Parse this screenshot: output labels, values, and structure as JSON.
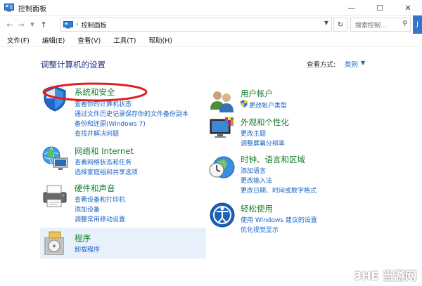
{
  "window": {
    "title": "控制面板"
  },
  "address": {
    "crumb": "控制面板",
    "separator": "›"
  },
  "search": {
    "placeholder": "搜索控制..."
  },
  "side_tab": "J",
  "menubar": {
    "items": [
      "文件(F)",
      "编辑(E)",
      "查看(V)",
      "工具(T)",
      "帮助(H)"
    ]
  },
  "main": {
    "heading": "调整计算机的设置",
    "view_by_label": "查看方式:",
    "view_by_value": "类别"
  },
  "left_categories": [
    {
      "title": "系统和安全",
      "links": [
        "查看你的计算机状态",
        "通过文件历史记录保存你的文件备份副本",
        "备份和还原(Windows 7)",
        "查找并解决问题"
      ]
    },
    {
      "title": "网络和 Internet",
      "links": [
        "查看网络状态和任务",
        "选择家庭组和共享选项"
      ]
    },
    {
      "title": "硬件和声音",
      "links": [
        "查看设备和打印机",
        "添加设备",
        "调整常用移动设置"
      ]
    },
    {
      "title": "程序",
      "links": [
        "卸载程序"
      ]
    }
  ],
  "right_categories": [
    {
      "title": "用户帐户",
      "links": [
        "更改帐户类型"
      ]
    },
    {
      "title": "外观和个性化",
      "links": [
        "更改主题",
        "调整屏幕分辨率"
      ]
    },
    {
      "title": "时钟、语言和区域",
      "links": [
        "添加语言",
        "更改输入法",
        "更改日期、时间或数字格式"
      ]
    },
    {
      "title": "轻松使用",
      "links": [
        "使用 Windows 建议的设置",
        "优化视觉显示"
      ]
    }
  ],
  "watermark": "3HE 当游网"
}
